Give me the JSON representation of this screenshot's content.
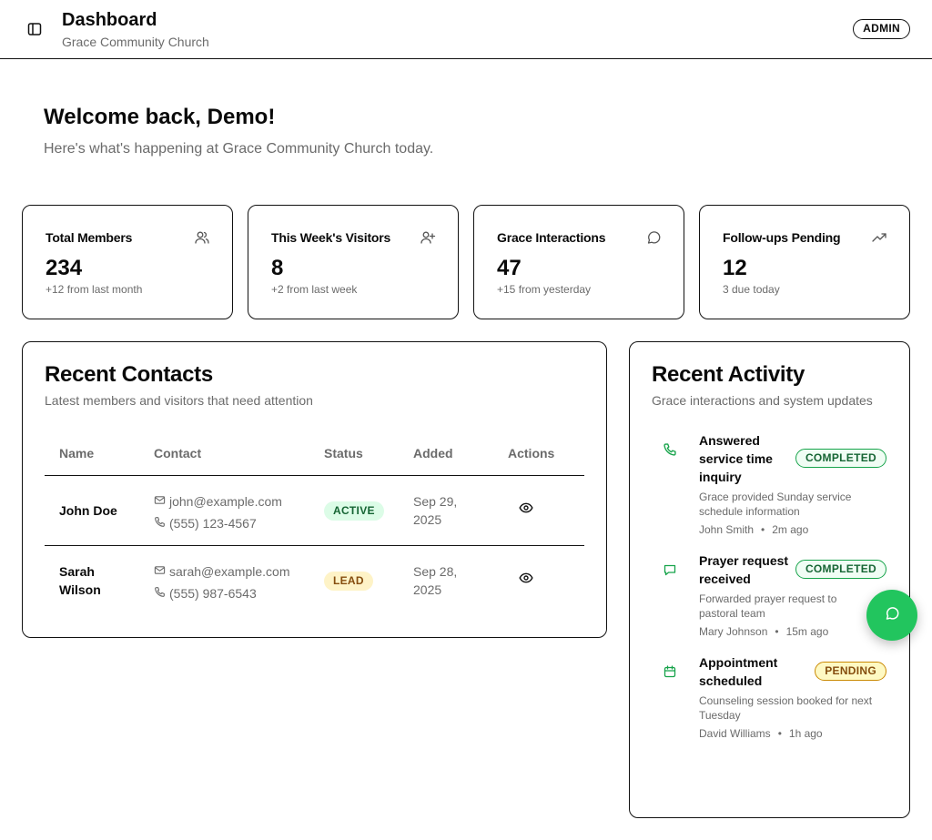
{
  "header": {
    "title": "Dashboard",
    "subtitle": "Grace Community Church",
    "role_badge": "ADMIN",
    "sidebar_toggle_icon": "panel-left-icon"
  },
  "welcome": {
    "title": "Welcome back, Demo!",
    "subtitle": "Here's what's happening at Grace Community Church today."
  },
  "stats": [
    {
      "label": "Total Members",
      "value": "234",
      "note": "+12 from last month",
      "icon": "users-icon"
    },
    {
      "label": "This Week's Visitors",
      "value": "8",
      "note": "+2 from last week",
      "icon": "user-plus-icon"
    },
    {
      "label": "Grace Interactions",
      "value": "47",
      "note": "+15 from yesterday",
      "icon": "message-circle-icon"
    },
    {
      "label": "Follow-ups Pending",
      "value": "12",
      "note": "3 due today",
      "icon": "trending-up-icon"
    }
  ],
  "contacts": {
    "title": "Recent Contacts",
    "subtitle": "Latest members and visitors that need attention",
    "columns": [
      "Name",
      "Contact",
      "Status",
      "Added",
      "Actions"
    ],
    "rows": [
      {
        "name_line1": "John Doe",
        "name_line2": "",
        "email": "john@example.com",
        "phone": "(555) 123-4567",
        "status": "ACTIVE",
        "added_line1": "Sep 29,",
        "added_line2": "2025"
      },
      {
        "name_line1": "Sarah",
        "name_line2": "Wilson",
        "email": "sarah@example.com",
        "phone": "(555) 987-6543",
        "status": "LEAD",
        "added_line1": "Sep 28,",
        "added_line2": "2025"
      }
    ]
  },
  "activity": {
    "title": "Recent Activity",
    "subtitle": "Grace interactions and system updates",
    "items": [
      {
        "title_lines": [
          "Answered",
          "service time",
          "inquiry"
        ],
        "badge": "COMPLETED",
        "desc_lines": [
          "Grace provided Sunday service",
          "schedule information"
        ],
        "person": "John Smith",
        "time": "2m ago",
        "icon": "phone-icon",
        "dot": "•"
      },
      {
        "title_lines": [
          "Prayer request",
          "received"
        ],
        "badge": "COMPLETED",
        "desc_lines": [
          "Forwarded prayer request to",
          "pastoral team"
        ],
        "person": "Mary Johnson",
        "time": "15m ago",
        "icon": "message-square-icon",
        "dot": "•"
      },
      {
        "title_lines": [
          "Appointment",
          "scheduled"
        ],
        "badge": "PENDING",
        "desc_lines": [
          "Counseling session booked for next",
          "Tuesday"
        ],
        "person": "David Williams",
        "time": "1h ago",
        "icon": "calendar-icon",
        "dot": "•"
      }
    ]
  },
  "fab": {
    "icon": "chat-icon"
  },
  "colors": {
    "accent_green": "#22c55e",
    "icon_green": "#16a34a",
    "border": "#111111",
    "muted_text": "#6b6b6b"
  }
}
